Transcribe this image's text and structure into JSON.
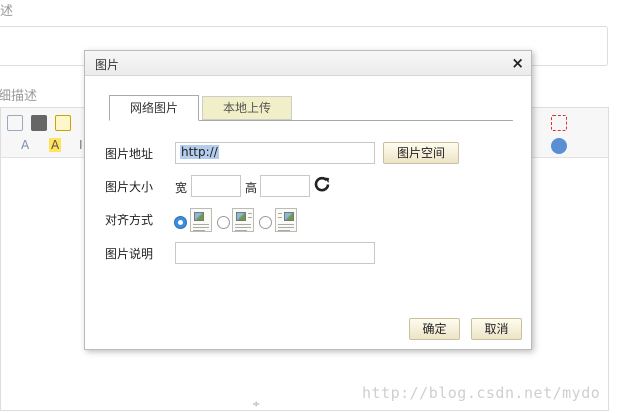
{
  "background": {
    "label_top": "述",
    "label_detail": "细描述",
    "toolbar_font_label": "A",
    "toolbar_highlight_label": "A",
    "toolbar_extra": "I"
  },
  "watermark": "http://blog.csdn.net/mydo",
  "dialog": {
    "title": "图片",
    "close_glyph": "×",
    "tabs": [
      {
        "label": "网络图片",
        "active": true
      },
      {
        "label": "本地上传",
        "active": false
      }
    ],
    "url_label": "图片地址",
    "url_value": "http://",
    "space_button": "图片空间",
    "size_label": "图片大小",
    "width_label": "宽",
    "height_label": "高",
    "align_label": "对齐方式",
    "align_selected": 0,
    "desc_label": "图片说明",
    "ok_button": "确定",
    "cancel_button": "取消"
  },
  "colors": {
    "radio_on": "#3c8ddc",
    "tab_inactive_bg": "#f0efc8",
    "button_bg": "#ece4c7",
    "selection": "#b4cdee"
  }
}
